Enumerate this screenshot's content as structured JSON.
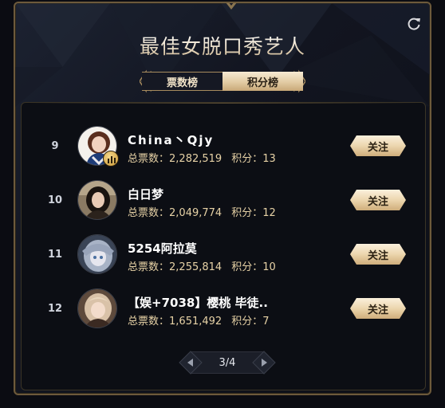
{
  "header": {
    "title": "最佳女脱口秀艺人"
  },
  "tabs": [
    {
      "label": "票数榜",
      "active": false
    },
    {
      "label": "积分榜",
      "active": true
    }
  ],
  "list": [
    {
      "rank": "9",
      "name": "China丶Qjy",
      "votes_label": "总票数：",
      "votes": "2,282,519",
      "points_label": "积分：",
      "points": "13",
      "follow": "关注",
      "has_badge": true
    },
    {
      "rank": "10",
      "name": "白日梦",
      "votes_label": "总票数：",
      "votes": "2,049,774",
      "points_label": "积分：",
      "points": "12",
      "follow": "关注",
      "has_badge": false
    },
    {
      "rank": "11",
      "name": "5254阿拉莫",
      "votes_label": "总票数：",
      "votes": "2,255,814",
      "points_label": "积分：",
      "points": "10",
      "follow": "关注",
      "has_badge": false
    },
    {
      "rank": "12",
      "name": "【娱+7038】樱桃 毕徒..",
      "votes_label": "总票数：",
      "votes": "1,651,492",
      "points_label": "积分：",
      "points": "7",
      "follow": "关注",
      "has_badge": false
    }
  ],
  "pager": {
    "label": "3/4"
  },
  "colors": {
    "gold": "#e7d2a6",
    "accent": "#c9a974",
    "background": "#0c0e14"
  },
  "icons": {
    "refresh": "refresh-icon",
    "prev": "chevron-left-icon",
    "next": "chevron-right-icon"
  }
}
